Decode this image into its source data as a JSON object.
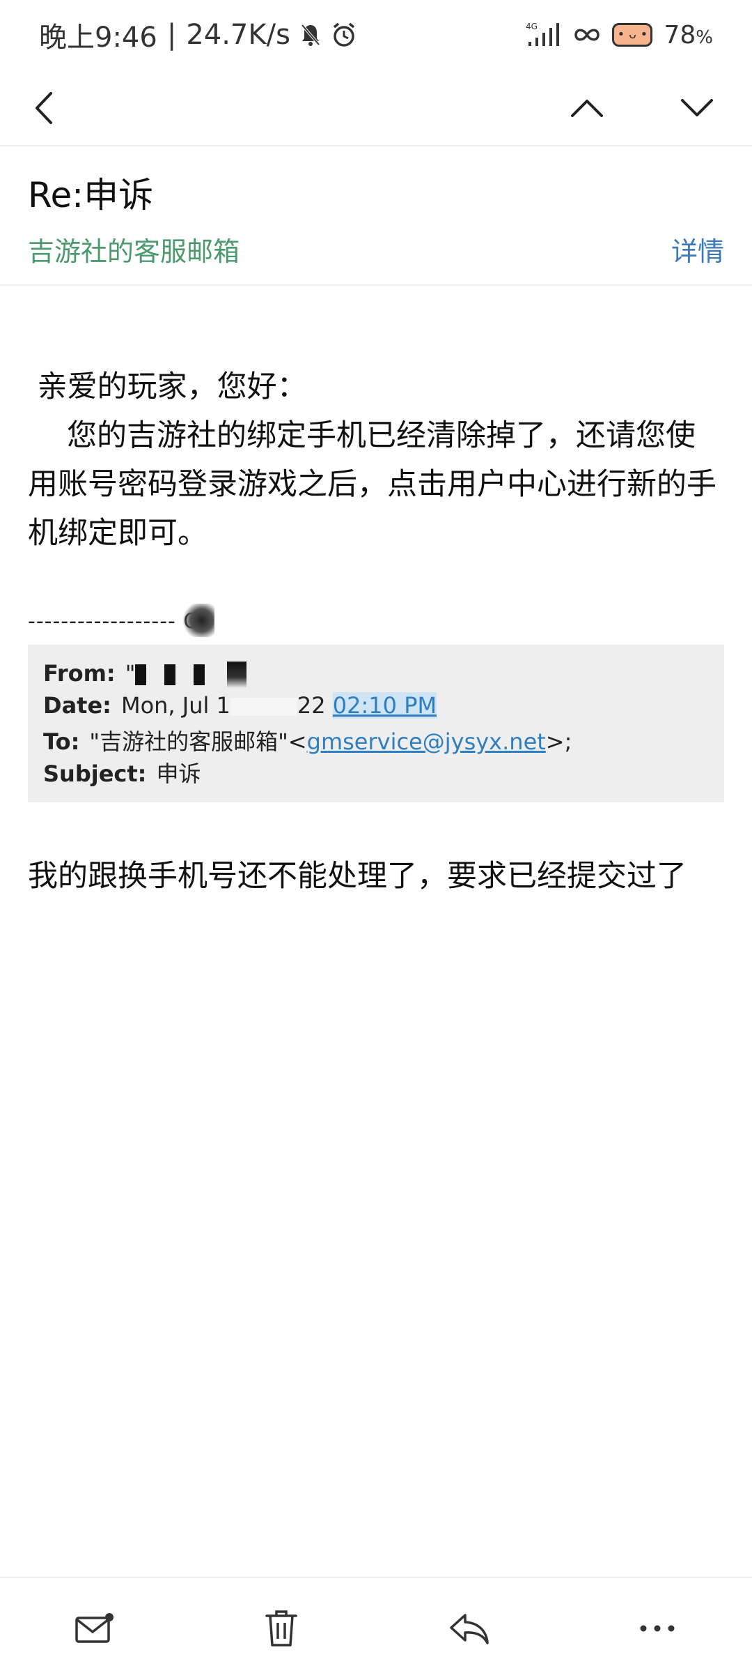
{
  "status_bar": {
    "time": "晚上9:46",
    "separator": "|",
    "network_speed": "24.7K/s",
    "network_type": "4G",
    "battery_percent": "78",
    "battery_unit": "%",
    "icons": [
      "mute-bell-icon",
      "alarm-icon",
      "signal-icon",
      "infinity-icon",
      "battery-icon"
    ]
  },
  "nav": {
    "icons": [
      "back-arrow-icon",
      "chevron-up-icon",
      "chevron-down-icon"
    ]
  },
  "email": {
    "subject": "Re:申诉",
    "sender": "吉游社的客服邮箱",
    "details_label": "详情",
    "greeting": "亲爱的玩家，您好：",
    "paragraph": "您的吉游社的绑定手机已经清除掉了，还请您使用账号密码登录游戏之后，点击用户中心进行新的手机绑定即可。",
    "quote_divider": "------------------ O",
    "quoted": {
      "from_label": "From:",
      "from_value_prefix": "\"",
      "date_label": "Date:",
      "date_prefix": "Mon, Jul 1",
      "date_suffix": "22 ",
      "date_time_link": "02:10 PM",
      "to_label": "To:",
      "to_name": "\"吉游社的客服邮箱\"<",
      "to_email": "gmservice@jysyx.net",
      "to_suffix": ">;",
      "subject_label": "Subject:",
      "subject_value": "申诉"
    },
    "original_message": "我的跟换手机号还不能处理了，要求已经提交过了"
  },
  "toolbar": {
    "icons": [
      "mail-icon",
      "trash-icon",
      "reply-icon",
      "more-icon"
    ]
  },
  "colors": {
    "sender_green": "#4a9a6e",
    "link_blue": "#3b79b7",
    "quote_bg": "#eeeeee"
  }
}
